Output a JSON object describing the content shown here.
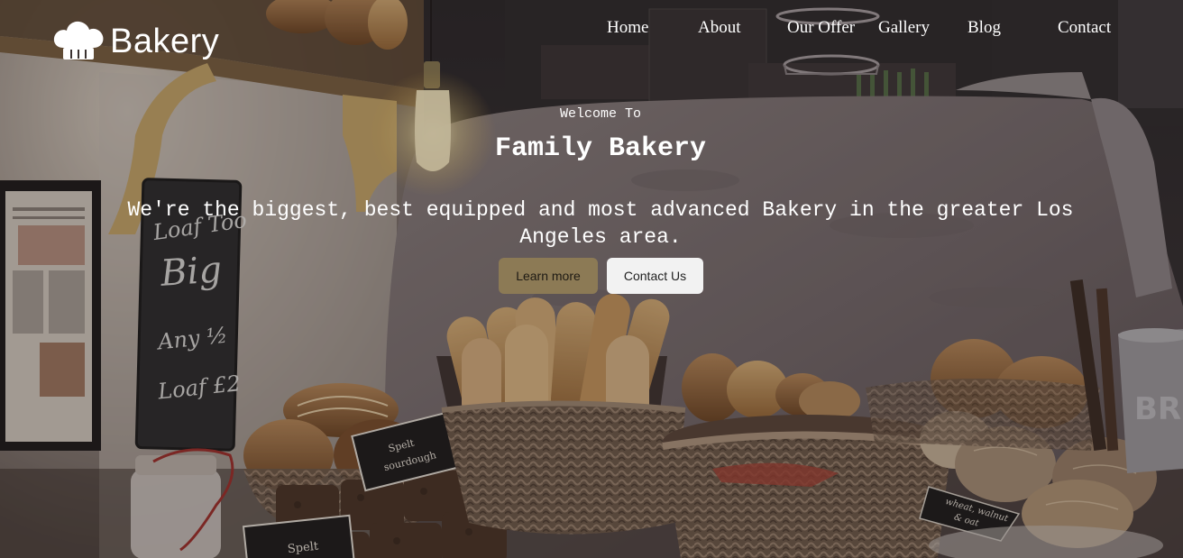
{
  "brand": {
    "name": "Bakery",
    "icon": "chef-hat-icon"
  },
  "nav": {
    "items": [
      {
        "label": "Home"
      },
      {
        "label": "About"
      },
      {
        "label": "Our Offer"
      },
      {
        "label": "Gallery"
      },
      {
        "label": "Blog"
      },
      {
        "label": "Contact"
      }
    ]
  },
  "hero": {
    "welcome": "Welcome To",
    "title": "Family Bakery",
    "tagline": "We're the biggest, best equipped and most advanced Bakery in the greater Los Angeles area.",
    "buttons": {
      "learn_more": "Learn more",
      "contact_us": "Contact Us"
    },
    "background": {
      "chalkboard": [
        "Loaf Too",
        "Big",
        "Any ½",
        "Loaf £2"
      ],
      "signs": [
        "Spelt sourdough",
        "Spelt",
        "wheat, walnut & oat"
      ]
    }
  },
  "colors": {
    "learn_more_bg": "#8c7a55",
    "contact_us_bg": "#f2f2f2",
    "text_light": "#ffffff"
  }
}
